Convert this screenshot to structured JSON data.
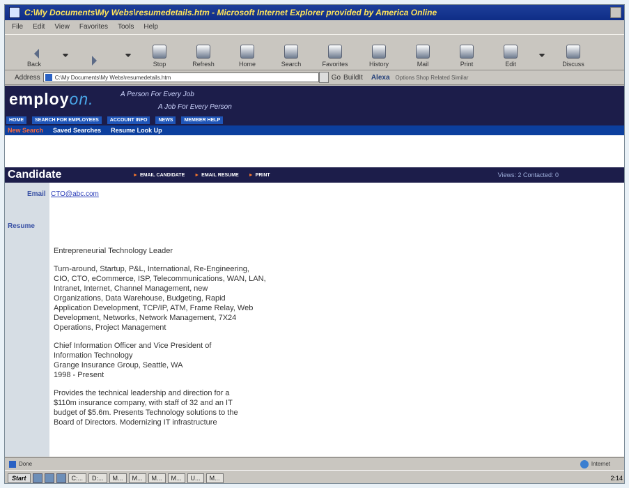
{
  "window": {
    "title": "C:\\My Documents\\My Webs\\resumedetails.htm - Microsoft Internet Explorer provided by America Online"
  },
  "menu": [
    "File",
    "Edit",
    "View",
    "Favorites",
    "Tools",
    "Help"
  ],
  "toolbar": {
    "back": "Back",
    "forward": "Forward",
    "stop": "Stop",
    "refresh": "Refresh",
    "home": "Home",
    "search": "Search",
    "favorites": "Favorites",
    "history": "History",
    "mail": "Mail",
    "print": "Print",
    "edit": "Edit",
    "discuss": "Discuss"
  },
  "address": {
    "label": "Address",
    "value": "C:\\My Documents\\My Webs\\resumedetails.htm",
    "go": "Go",
    "buildit": "BuildIt",
    "alexa": "Alexa",
    "extras": "Options  Shop  Related  Similar"
  },
  "site": {
    "logo_main": "employ",
    "logo_accent": "on.",
    "tagline1": "A Person For Every Job",
    "tagline2": "A Job For Every Person",
    "nav": [
      "HOME",
      "SEARCH FOR EMPLOYEES",
      "ACCOUNT INFO",
      "NEWS",
      "MEMBER HELP"
    ],
    "subnav": {
      "new_search": "New Search",
      "saved_searches": "Saved Searches",
      "resume_lookup": "Resume Look Up"
    }
  },
  "candidate": {
    "title": "Candidate",
    "email_candidate": "EMAIL CANDIDATE",
    "email_resume": "EMAIL RESUME",
    "print": "PRINT",
    "views": "Views: 2  Contacted: 0",
    "email_label": "Email",
    "email_value": "CTO@abc.com",
    "resume_label": "Resume",
    "resume_paragraphs": [
      "Entrepreneurial Technology Leader",
      "Turn-around, Startup, P&L, International, Re-Engineering,\nCIO, CTO, eCommerce, ISP, Telecommunications, WAN, LAN,\nIntranet, Internet, Channel Management, new\nOrganizations, Data Warehouse, Budgeting, Rapid\nApplication Development, TCP/IP, ATM, Frame Relay, Web\nDevelopment, Networks, Network Management, 7X24\nOperations, Project Management",
      "Chief Information Officer and Vice President of\nInformation Technology\nGrange Insurance Group, Seattle, WA\n1998 - Present",
      "Provides the technical leadership and direction for a\n$110m insurance company, with staff of 32 and an IT\nbudget of $5.6m. Presents Technology solutions to the\nBoard of Directors. Modernizing IT infrastructure"
    ]
  },
  "status": {
    "left": "Done",
    "zone": "Internet"
  },
  "taskbar": {
    "start": "Start",
    "tasks": [
      "C:...",
      "D:...",
      "M...",
      "M...",
      "M...",
      "M...",
      "U...",
      "M..."
    ],
    "clock": "2:14"
  }
}
